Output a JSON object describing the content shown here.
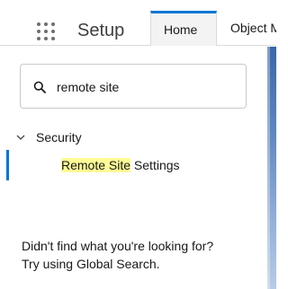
{
  "header": {
    "app_name": "Setup",
    "tabs": [
      {
        "label": "Home"
      },
      {
        "label": "Object M"
      }
    ]
  },
  "search": {
    "value": "remote site"
  },
  "tree": {
    "section_label": "Security",
    "item": {
      "match": "Remote Site",
      "rest": " Settings"
    }
  },
  "help": {
    "line1": "Didn't find what you're looking for?",
    "line2": "Try using Global Search."
  },
  "colors": {
    "accent": "#0176d3",
    "highlight": "#fffb96"
  },
  "icons": [
    "app-launcher-icon",
    "search-icon",
    "chevron-down-icon"
  ]
}
